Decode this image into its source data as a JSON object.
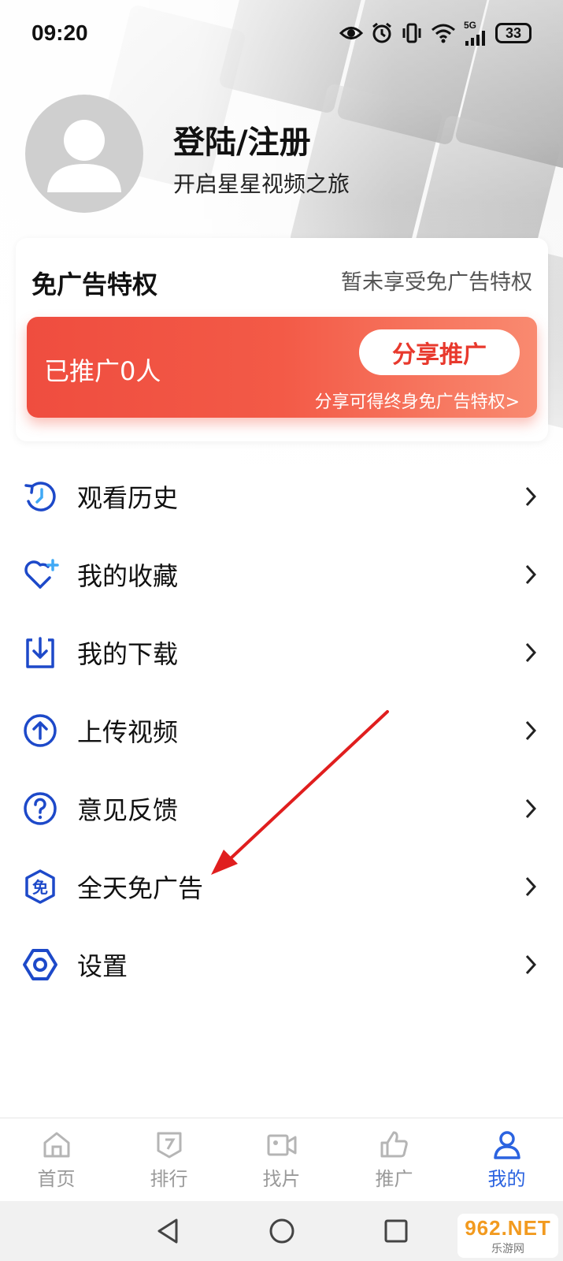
{
  "status_bar": {
    "time": "09:20",
    "network": "5G",
    "battery": "33"
  },
  "profile": {
    "title": "登陆/注册",
    "subtitle": "开启星星视频之旅"
  },
  "ad_card": {
    "title": "免广告特权",
    "status": "暂未享受免广告特权",
    "promoted_count": "已推广0人",
    "share_label": "分享推广",
    "hint": "分享可得终身免广告特权>"
  },
  "menu": {
    "items": [
      {
        "label": "观看历史",
        "icon": "history-icon"
      },
      {
        "label": "我的收藏",
        "icon": "favorite-heart-icon"
      },
      {
        "label": "我的下载",
        "icon": "download-icon"
      },
      {
        "label": "上传视频",
        "icon": "upload-icon"
      },
      {
        "label": "意见反馈",
        "icon": "question-icon"
      },
      {
        "label": "全天免广告",
        "icon": "ad-free-icon",
        "icon_char": "免"
      },
      {
        "label": "设置",
        "icon": "settings-icon"
      }
    ]
  },
  "bottom_nav": {
    "tabs": [
      {
        "label": "首页",
        "icon": "home-icon"
      },
      {
        "label": "排行",
        "icon": "ranking-icon"
      },
      {
        "label": "找片",
        "icon": "video-camera-icon"
      },
      {
        "label": "推广",
        "icon": "thumbs-up-icon"
      },
      {
        "label": "我的",
        "icon": "user-icon",
        "active": true
      }
    ]
  },
  "watermark": {
    "main": "962.NET",
    "sub": "乐游网"
  },
  "colors": {
    "accent": "#2b63e0",
    "promo_red": "#ef4d3f",
    "icon_blue": "#1d49c9",
    "annotation_red": "#e01e1e"
  }
}
